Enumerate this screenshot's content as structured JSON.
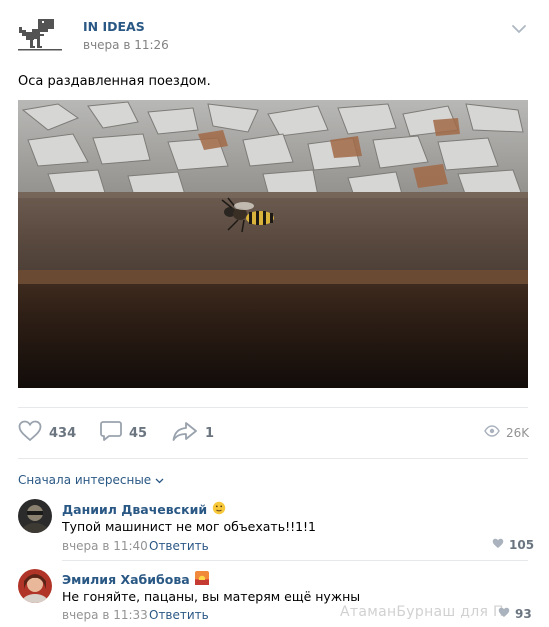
{
  "post": {
    "community_name": "IN IDEAS",
    "time": "вчера в 11:26",
    "text": "Оса раздавленная поездом.",
    "photo_icon": "wasp-on-rail-photo"
  },
  "actions": {
    "likes": "434",
    "comments": "45",
    "shares": "1",
    "views": "26K"
  },
  "comments_section": {
    "sort_label": "Сначала интересные",
    "items": [
      {
        "author": "Даниил Двачевский",
        "badge_icon": "emoji-face-icon",
        "text": "Тупой машинист не мог объехать!!1!1",
        "time": "вчера в 11:40",
        "reply_label": "Ответить",
        "likes": "105"
      },
      {
        "author": "Эмилия Хабибова",
        "badge_icon": "sunset-emoji-icon",
        "text": "Не гоняйте, пацаны, вы матерям ещё нужны",
        "time": "вчера в 11:33",
        "reply_label": "Ответить",
        "likes": "93"
      }
    ]
  },
  "watermark": "АтаманБурнаш для П",
  "colors": {
    "link": "#2a5885",
    "muted": "#939393",
    "divider": "#e7e8ec",
    "icon": "#99a2ad"
  }
}
